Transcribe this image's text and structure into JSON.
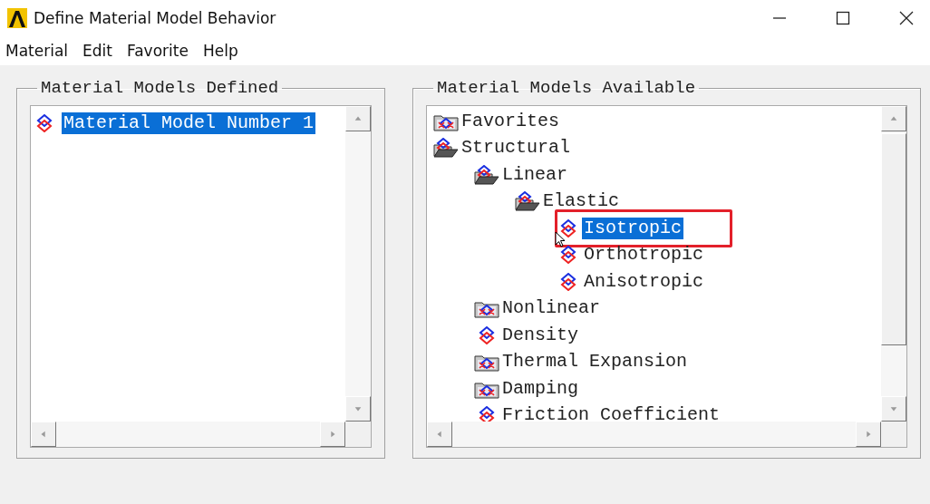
{
  "window": {
    "title": "Define Material Model Behavior"
  },
  "menu": [
    "Material",
    "Edit",
    "Favorite",
    "Help"
  ],
  "defined": {
    "title": "Material Models Defined",
    "items": [
      {
        "label": "Material Model Number 1",
        "selected": true
      }
    ]
  },
  "available": {
    "title": "Material Models Available",
    "tree": [
      {
        "label": "Favorites",
        "kind": "folder",
        "expanded": false,
        "selected": false
      },
      {
        "label": "Structural",
        "kind": "folder",
        "expanded": true,
        "selected": false,
        "children": [
          {
            "label": "Linear",
            "kind": "folder",
            "expanded": true,
            "selected": false,
            "children": [
              {
                "label": "Elastic",
                "kind": "folder",
                "expanded": true,
                "selected": false,
                "children": [
                  {
                    "label": "Isotropic",
                    "kind": "leaf",
                    "selected": true,
                    "highlighted": true
                  },
                  {
                    "label": "Orthotropic",
                    "kind": "leaf",
                    "selected": false
                  },
                  {
                    "label": "Anisotropic",
                    "kind": "leaf",
                    "selected": false
                  }
                ]
              }
            ]
          },
          {
            "label": "Nonlinear",
            "kind": "folder",
            "expanded": false,
            "selected": false
          },
          {
            "label": "Density",
            "kind": "leaf",
            "selected": false
          },
          {
            "label": "Thermal Expansion",
            "kind": "folder",
            "expanded": false,
            "selected": false
          },
          {
            "label": "Damping",
            "kind": "folder",
            "expanded": false,
            "selected": false
          },
          {
            "label": "Friction Coefficient",
            "kind": "leaf",
            "selected": false
          }
        ]
      }
    ]
  }
}
